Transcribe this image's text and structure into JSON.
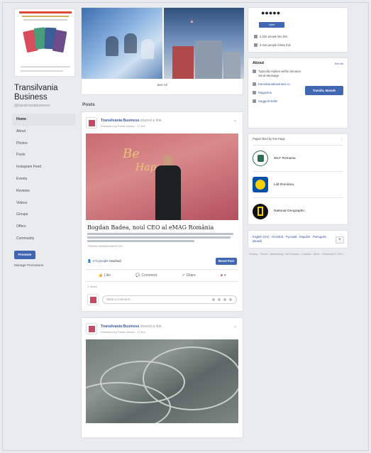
{
  "page": {
    "name": "Transilvania Business",
    "handle": "@transilvaniabusiness",
    "cover_thumb_caption": "2017 2 AN DE TRANSILVANIA"
  },
  "nav": {
    "items": [
      "Home",
      "About",
      "Photos",
      "Posts",
      "Instagram Feed",
      "Events",
      "Reviews",
      "Videos",
      "Groups",
      "Offers",
      "Community"
    ],
    "active_index": 0,
    "promote_label": "Promote",
    "manage_label": "Manage Promotions"
  },
  "center": {
    "see_all_label": "See All",
    "posts_heading": "Posts",
    "post1": {
      "author": "Transilvania Business",
      "author_suffix": "shared a link.",
      "meta": "Published by Paula Haiduc · 17 hrs",
      "image_text_1": "Be",
      "image_text_2": "Happy",
      "headline": "Bogdan Badea, noul CEO al eMAG România",
      "date_line": "TRANSILVANIABUSINESS.RO",
      "reach_count": "173 people",
      "reach_suffix": "reached",
      "boost_label": "Boost Post",
      "like_label": "Like",
      "comment_label": "Comment",
      "share_label": "Share",
      "likes_line": "1 Share",
      "comment_placeholder": "Write a comment..."
    },
    "post2": {
      "author": "Transilvania Business",
      "author_suffix": "shared a link.",
      "meta": "Published by Paula Haiduc · 17 hrs"
    }
  },
  "right": {
    "like_button": "Liked",
    "stat1": "2,334 people like this",
    "stat2": "2,315 people follow this",
    "about_heading": "About",
    "about_link": "See All",
    "about_row1": "Typically replies within minutes",
    "about_row1b": "Send Message",
    "about_row2": "transilvaniabusiness.ro",
    "about_row3": "Magazine",
    "about_row4": "Suggest Edits",
    "message_button": "Transilv. Manule",
    "liked_heading": "Pages liked by this Page",
    "liked_pages": [
      {
        "name": "WLF Romania",
        "color": "#2c6e4f"
      },
      {
        "name": "Lidl România",
        "color": "#f4d100"
      },
      {
        "name": "National Geographic",
        "color": "#111111"
      }
    ],
    "languages": "English (US) · Română · Русский · Español · Português (Brasil)",
    "footer": "Privacy · Terms · Advertising · Ad Choices · Cookies · More · Facebook © 2017"
  },
  "colors": {
    "brand": "#4267b2",
    "link": "#385898",
    "background": "#e9ebee"
  }
}
